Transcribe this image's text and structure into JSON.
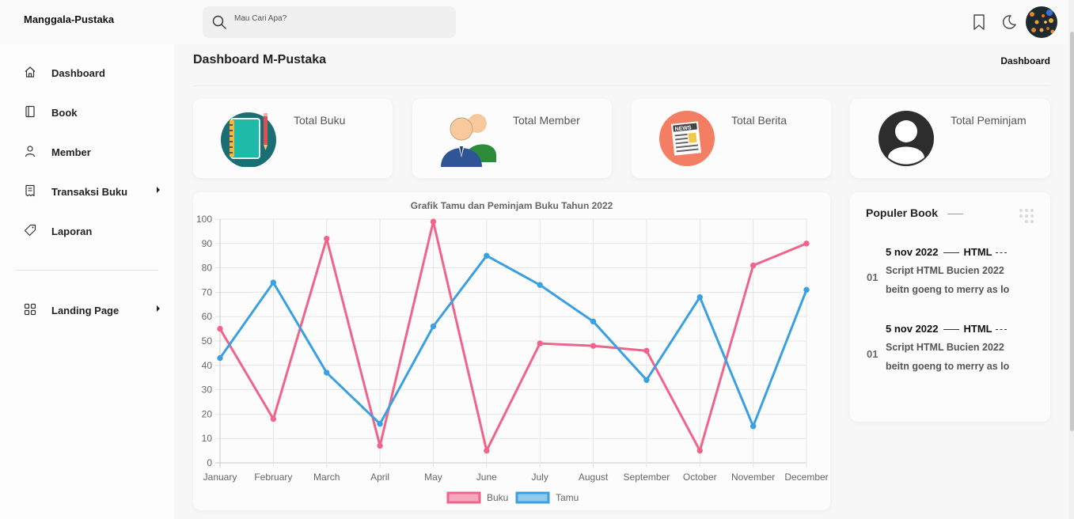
{
  "brand": "Manggala-Pustaka",
  "search": {
    "placeholder": "Mau Cari Apa?"
  },
  "header_icons": [
    "bookmark-icon",
    "moon-icon",
    "user-avatar"
  ],
  "sidebar": {
    "items": [
      {
        "label": "Dashboard",
        "icon": "home-icon"
      },
      {
        "label": "Book",
        "icon": "book-icon"
      },
      {
        "label": "Member",
        "icon": "user-icon"
      },
      {
        "label": "Transaksi Buku",
        "icon": "receipt-icon",
        "has_submenu": true
      },
      {
        "label": "Laporan",
        "icon": "tag-icon"
      },
      {
        "label": "Landing Page",
        "icon": "grid-icon",
        "has_submenu": true
      }
    ]
  },
  "page": {
    "title": "Dashboard M-Pustaka",
    "breadcrumb": "Dashboard"
  },
  "stats": [
    {
      "label": "Total Buku",
      "icon": "notebook-icon"
    },
    {
      "label": "Total Member",
      "icon": "members-icon"
    },
    {
      "label": "Total Berita",
      "icon": "news-icon"
    },
    {
      "label": "Total Peminjam",
      "icon": "borrower-icon"
    }
  ],
  "chart_data": {
    "type": "line",
    "title": "Grafik Tamu dan Peminjam Buku Tahun 2022",
    "categories": [
      "January",
      "February",
      "March",
      "April",
      "May",
      "June",
      "July",
      "August",
      "September",
      "October",
      "November",
      "December"
    ],
    "series": [
      {
        "name": "Buku",
        "color": "#f0648a",
        "values": [
          55,
          18,
          92,
          7,
          99,
          5,
          49,
          48,
          46,
          5,
          81,
          90
        ]
      },
      {
        "name": "Tamu",
        "color": "#3aa0e2",
        "values": [
          43,
          74,
          37,
          16,
          56,
          85,
          73,
          58,
          34,
          68,
          15,
          71
        ]
      }
    ],
    "ylim": [
      0,
      100
    ],
    "yticks": [
      0,
      10,
      20,
      30,
      40,
      50,
      60,
      70,
      80,
      90,
      100
    ],
    "grid": true,
    "legend": "bottom"
  },
  "popular": {
    "title": "Populer Book",
    "items": [
      {
        "num": "01",
        "date": "5 nov 2022",
        "tag": "HTML",
        "title": "Script HTML Bucien 2022",
        "desc": "beitn goeng to merry as lo"
      },
      {
        "num": "01",
        "date": "5 nov 2022",
        "tag": "HTML",
        "title": "Script HTML Bucien 2022",
        "desc": "beitn goeng to merry as lo"
      }
    ]
  }
}
